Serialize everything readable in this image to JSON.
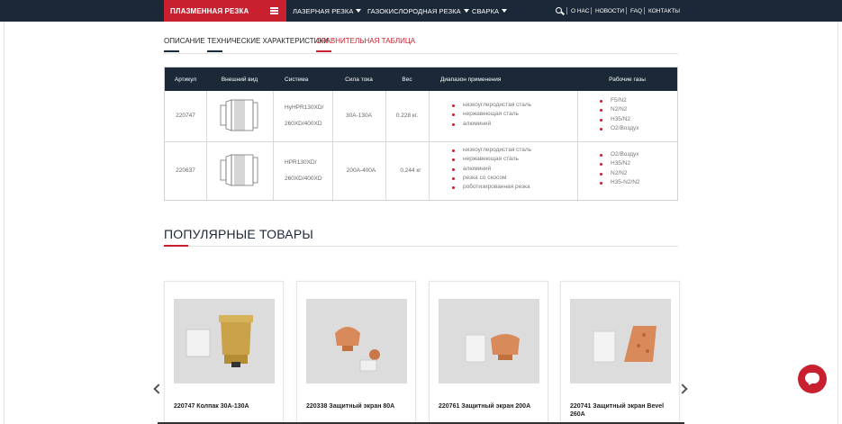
{
  "nav": {
    "active_label": "ПЛАЗМЕННАЯ РЕЗКА",
    "items": [
      {
        "label": "ЛАЗЕРНАЯ РЕЗКА"
      },
      {
        "label": "ГАЗОКИСЛОРОДНАЯ РЕЗКА"
      },
      {
        "label": "СВАРКА"
      }
    ],
    "right_links": [
      "О НАС",
      "НОВОСТИ",
      "FAQ",
      "КОНТАКТЫ"
    ]
  },
  "tabs": [
    {
      "label": "ОПИСАНИЕ",
      "active": false
    },
    {
      "label": "ТЕХНИЧЕСКИЕ ХАРАКТЕРИСТИКИ",
      "active": false
    },
    {
      "label": "СРАВНИТЕЛЬНАЯ ТАБЛИЦА",
      "active": true
    }
  ],
  "table": {
    "headers": [
      "Артикул",
      "Внешний вид",
      "Система",
      "Сила тока",
      "Вес",
      "Диапазон применения",
      "Рабочие газы"
    ],
    "rows": [
      {
        "article": "220747",
        "system": [
          "HyHPR130XD/",
          "260XD/400XD"
        ],
        "current": "30A-130A",
        "weight": "0.228 кг.",
        "applications": [
          "низкоуглеродистая сталь",
          "нержавеющая сталь",
          "алюминий"
        ],
        "gases": [
          "F5/N2",
          "N2/N2",
          "H35/N2",
          "O2/Воздух"
        ]
      },
      {
        "article": "220637",
        "system": [
          "HPR130XD/",
          "260XD/400XD"
        ],
        "current": "200A-400A",
        "weight": "0.244 кг",
        "applications": [
          "низкоуглеродистая сталь",
          "нержавеющая сталь",
          "алюминий",
          "резка со скосом",
          "роботизированная резка"
        ],
        "gases": [
          "O2/Воздух",
          "H35/N2",
          "N2/N2",
          "H35-N2/N2"
        ]
      }
    ]
  },
  "popular": {
    "title": "ПОПУЛЯРНЫЕ ТОВАРЫ",
    "products": [
      {
        "name": "220747 Колпак 30А-130А"
      },
      {
        "name": "220338 Защитный экран 80А"
      },
      {
        "name": "220761 Защитный экран 200А"
      },
      {
        "name": "220741 Защитный экран Bevel 260А"
      }
    ]
  },
  "colors": {
    "accent": "#c8202f",
    "navy": "#1a2838"
  },
  "icons": {
    "search": "search-icon",
    "menu": "hamburger-icon",
    "chat": "chat-icon",
    "prev": "chevron-left-icon",
    "next": "chevron-right-icon"
  }
}
